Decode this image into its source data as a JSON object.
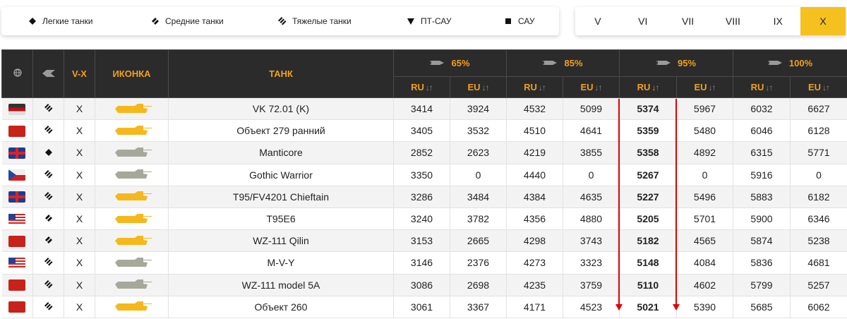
{
  "filters": {
    "light": {
      "label": "Легкие танки",
      "icon": "diamond-icon"
    },
    "medium": {
      "label": "Средние танки",
      "icon": "double-chevron-icon"
    },
    "heavy": {
      "label": "Тяжелые танки",
      "icon": "triple-chevron-icon"
    },
    "td": {
      "label": "ПТ-САУ",
      "icon": "triangle-down-icon"
    },
    "spg": {
      "label": "САУ",
      "icon": "square-icon"
    }
  },
  "tiers": [
    "V",
    "VI",
    "VII",
    "VIII",
    "IX",
    "X"
  ],
  "active_tier": "X",
  "table": {
    "headers": {
      "nation_icon": "globe-icon",
      "class_icon": "tank-class-icon",
      "tier": "V-X",
      "icon": "ИКОНКА",
      "tank": "ТАНК",
      "acc1": "65%",
      "acc2": "85%",
      "acc3": "95%",
      "acc4": "100%",
      "ru": "RU",
      "eu": "EU",
      "sort_arrows": "↓↑",
      "sort_down": "↓",
      "sort_up": "↑"
    },
    "rows": [
      {
        "nation": "germany",
        "cls": "heavy",
        "tier": "X",
        "tank": "VK 72.01 (K)",
        "v": [
          "3414",
          "3924",
          "4532",
          "5099",
          "5374",
          "5967",
          "6032",
          "6627"
        ]
      },
      {
        "nation": "ussr",
        "cls": "heavy",
        "tier": "X",
        "tank": "Объект 279 ранний",
        "v": [
          "3405",
          "3532",
          "4510",
          "4641",
          "5359",
          "5480",
          "6046",
          "6128"
        ]
      },
      {
        "nation": "uk",
        "cls": "light",
        "tier": "X",
        "tank": "Manticore",
        "v": [
          "2852",
          "2623",
          "4219",
          "3855",
          "5358",
          "4892",
          "6315",
          "5771"
        ]
      },
      {
        "nation": "czech",
        "cls": "heavy",
        "tier": "X",
        "tank": "Gothic Warrior",
        "v": [
          "3350",
          "0",
          "4440",
          "0",
          "5267",
          "0",
          "5916",
          "0"
        ]
      },
      {
        "nation": "uk",
        "cls": "heavy",
        "tier": "X",
        "tank": "T95/FV4201 Chieftain",
        "v": [
          "3286",
          "3484",
          "4384",
          "4635",
          "5227",
          "5496",
          "5883",
          "6182"
        ]
      },
      {
        "nation": "usa",
        "cls": "medium",
        "tier": "X",
        "tank": "T95E6",
        "v": [
          "3240",
          "3782",
          "4356",
          "4880",
          "5205",
          "5701",
          "5900",
          "6346"
        ]
      },
      {
        "nation": "china",
        "cls": "medium",
        "tier": "X",
        "tank": "WZ-111 Qilin",
        "v": [
          "3153",
          "2665",
          "4298",
          "3743",
          "5182",
          "4565",
          "5874",
          "5238"
        ]
      },
      {
        "nation": "usa",
        "cls": "heavy",
        "tier": "X",
        "tank": "M-V-Y",
        "v": [
          "3146",
          "2376",
          "4273",
          "3323",
          "5148",
          "4084",
          "5836",
          "4681"
        ]
      },
      {
        "nation": "china",
        "cls": "heavy",
        "tier": "X",
        "tank": "WZ-111 model 5A",
        "v": [
          "3086",
          "2698",
          "4235",
          "3759",
          "5110",
          "4602",
          "5799",
          "5257"
        ]
      },
      {
        "nation": "ussr",
        "cls": "heavy",
        "tier": "X",
        "tank": "Объект 260",
        "v": [
          "3061",
          "3367",
          "4171",
          "4523",
          "5021",
          "5390",
          "5685",
          "6062"
        ]
      }
    ]
  },
  "colors": {
    "accent": "#f0a01e",
    "tier_active": "#f4c11f",
    "header_bg": "#2b2b2b",
    "tank_gold": "#f5b81c",
    "tank_gray": "#a6a99a",
    "arrow_red": "#e10000"
  }
}
